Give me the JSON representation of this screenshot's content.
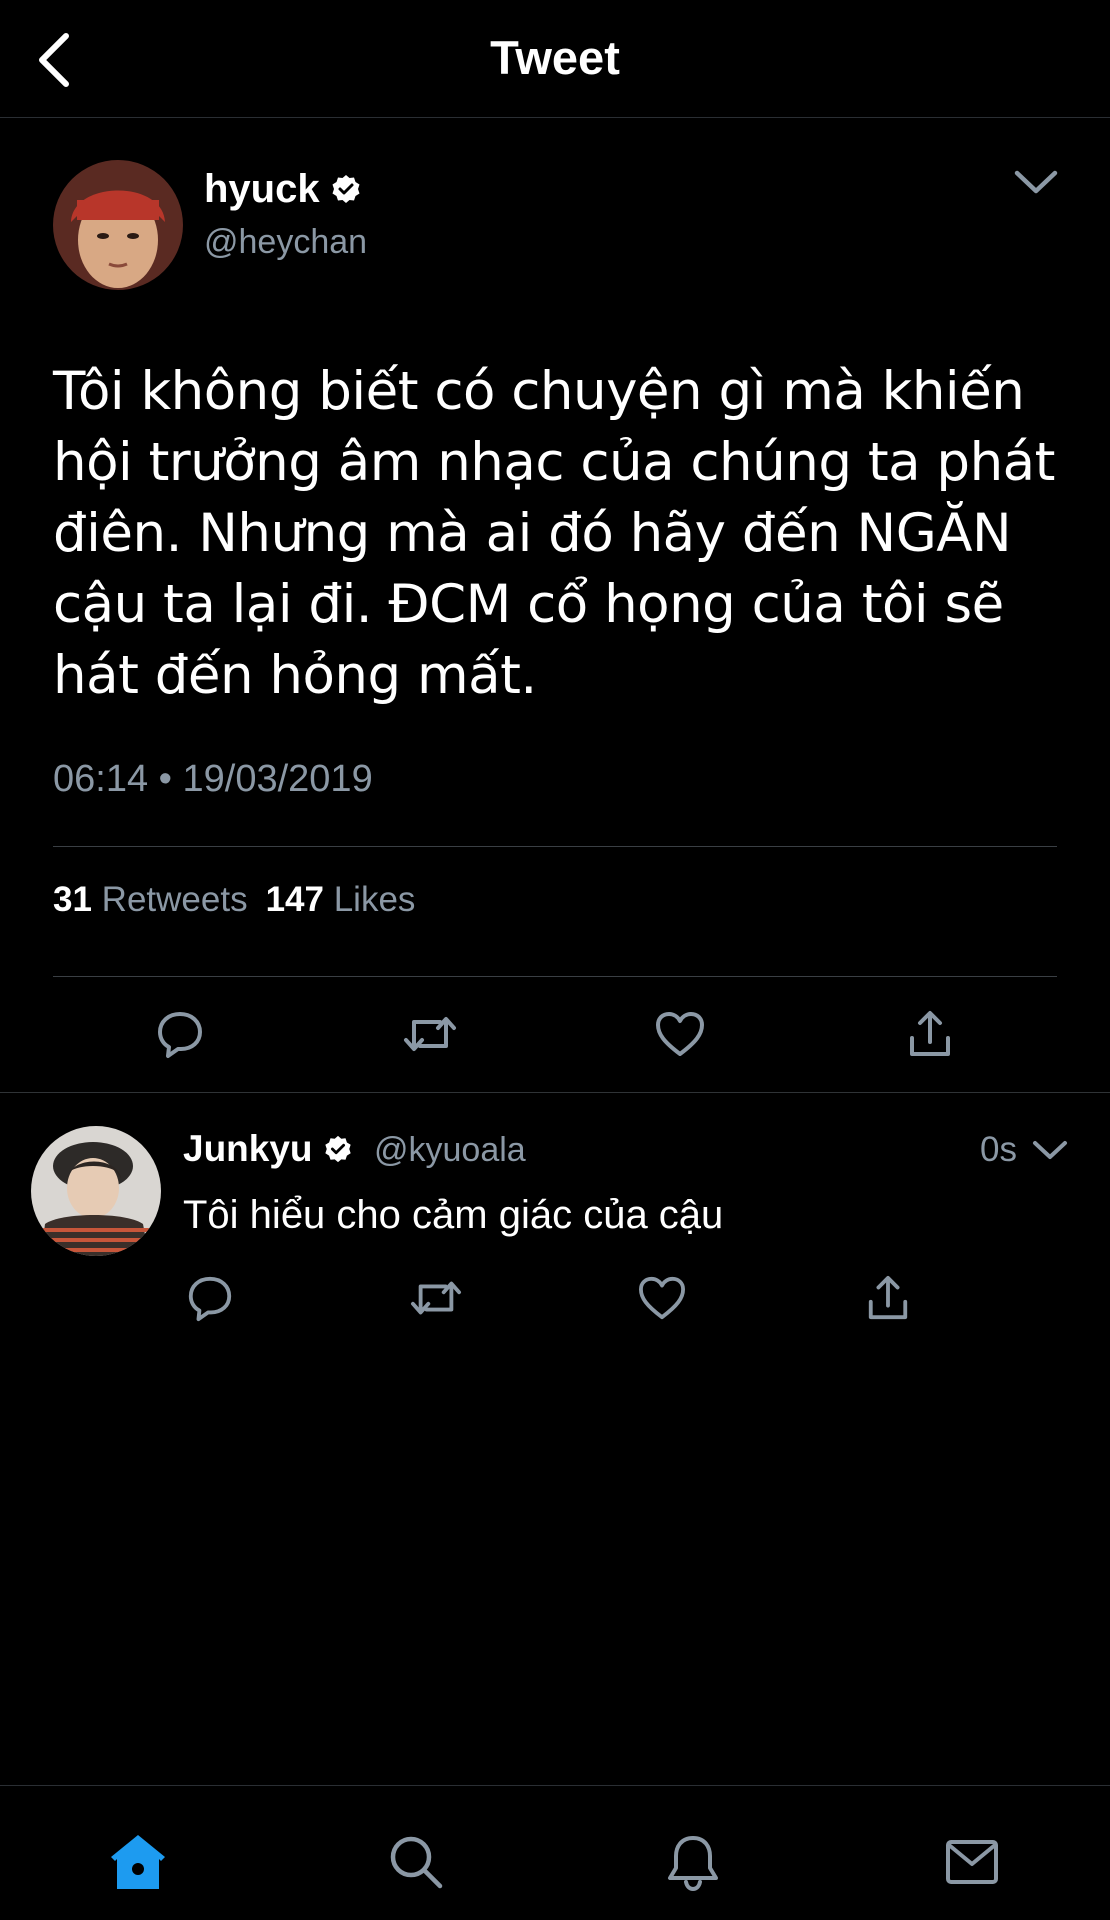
{
  "header": {
    "title": "Tweet",
    "back_icon": "chevron-left-icon"
  },
  "main_tweet": {
    "author": {
      "name": "hyuck",
      "handle": "@heychan",
      "verified": true
    },
    "text": "Tôi không biết có chuyện gì mà khiến hội trưởng âm nhạc của chúng ta phát điên. Nhưng mà ai đó hãy đến NGĂN cậu ta lại đi. ĐCM cổ họng của tôi sẽ hát đến hỏng mất.",
    "timestamp": "06:14 • 19/03/2019",
    "stats": {
      "retweets_count": "31",
      "retweets_label": "Retweets",
      "likes_count": "147",
      "likes_label": "Likes"
    },
    "actions": [
      "reply-icon",
      "retweet-icon",
      "like-icon",
      "share-icon"
    ]
  },
  "reply_tweet": {
    "author": {
      "name": "Junkyu",
      "handle": "@kyuoala",
      "verified": true
    },
    "time": "0s",
    "text": "Tôi hiểu cho cảm giác của cậu",
    "actions": [
      "reply-icon",
      "retweet-icon",
      "like-icon",
      "share-icon"
    ]
  },
  "bottom_nav": {
    "items": [
      "home-icon",
      "search-icon",
      "notifications-icon",
      "messages-icon"
    ],
    "active": "home-icon"
  },
  "colors": {
    "background": "#000000",
    "text_primary": "#ffffff",
    "text_secondary": "#8b98a5",
    "divider": "#3a3f44",
    "accent": "#1d9bf0"
  }
}
